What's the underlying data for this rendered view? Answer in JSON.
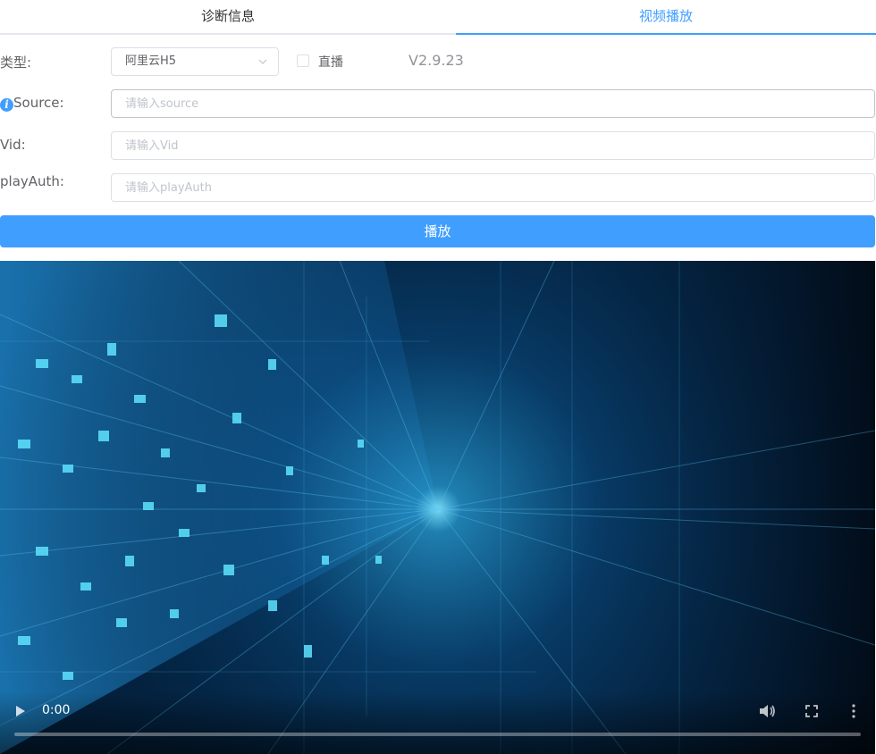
{
  "tabs": [
    {
      "label": "诊断信息",
      "active": false
    },
    {
      "label": "视频播放",
      "active": true
    }
  ],
  "form": {
    "type_label": "类型:",
    "type_value": "阿里云H5",
    "live_label": "直播",
    "live_checked": false,
    "version": "V2.9.23",
    "source_label": "Source:",
    "source_placeholder": "请输入source",
    "source_value": "",
    "vid_label": "Vid:",
    "vid_placeholder": "请输入Vid",
    "vid_value": "",
    "playauth_label": "playAuth:",
    "playauth_placeholder": "请输入playAuth",
    "playauth_value": "",
    "play_button": "播放"
  },
  "video": {
    "current_time": "0:00",
    "progress": 0,
    "icons": [
      "play-icon",
      "volume-icon",
      "fullscreen-icon",
      "more-options-icon"
    ]
  },
  "colors": {
    "primary": "#409eff",
    "text": "#606266",
    "placeholder": "#c0c4cc",
    "border": "#dcdfe6"
  }
}
